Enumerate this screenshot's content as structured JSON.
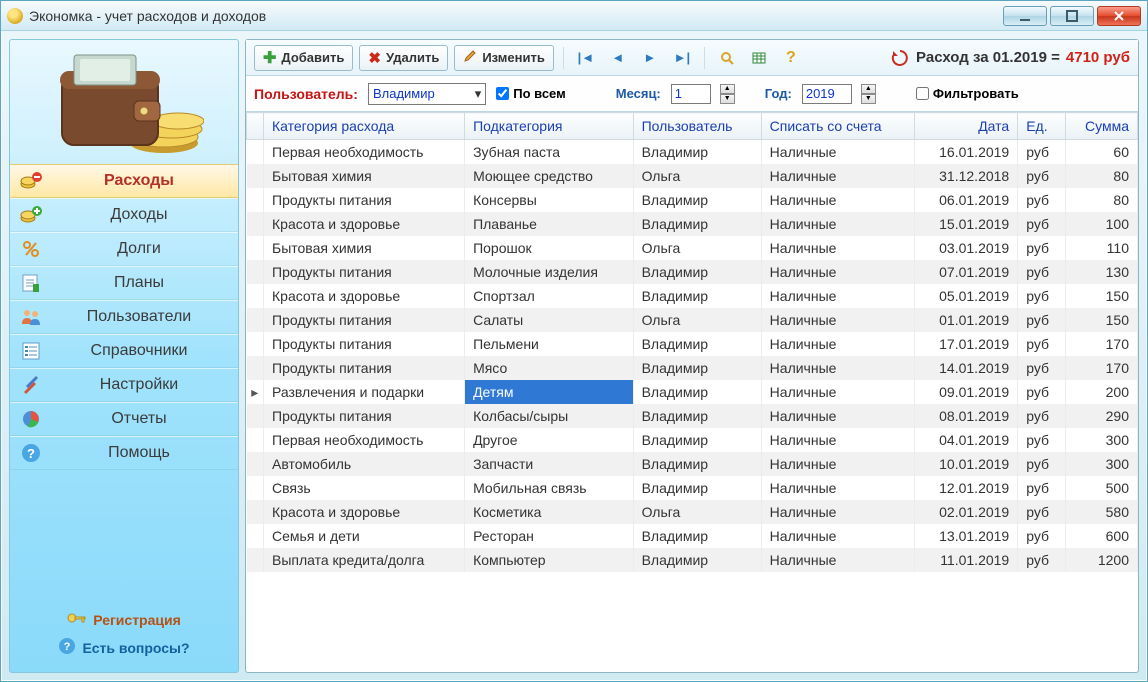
{
  "window": {
    "title": "Экономка - учет расходов и доходов"
  },
  "sidebar": {
    "items": [
      {
        "label": "Расходы"
      },
      {
        "label": "Доходы"
      },
      {
        "label": "Долги"
      },
      {
        "label": "Планы"
      },
      {
        "label": "Пользователи"
      },
      {
        "label": "Справочники"
      },
      {
        "label": "Настройки"
      },
      {
        "label": "Отчеты"
      },
      {
        "label": "Помощь"
      }
    ],
    "registration": "Регистрация",
    "questions": "Есть вопросы?"
  },
  "toolbar": {
    "add": "Добавить",
    "del": "Удалить",
    "edit": "Изменить",
    "summary_prefix": "Расход за 01.2019 = ",
    "summary_value": "4710 руб"
  },
  "filter": {
    "user_label": "Пользователь:",
    "user_value": "Владимир",
    "all_label": "По всем",
    "month_label": "Месяц:",
    "month_value": "1",
    "year_label": "Год:",
    "year_value": "2019",
    "filter_label": "Фильтровать"
  },
  "columns": [
    "Категория расхода",
    "Подкатегория",
    "Пользователь",
    "Списать со счета",
    "Дата",
    "Ед.",
    "Сумма"
  ],
  "rows": [
    {
      "cat": "Первая необходимость",
      "sub": "Зубная паста",
      "user": "Владимир",
      "acc": "Наличные",
      "date": "16.01.2019",
      "unit": "руб",
      "sum": "60",
      "sel": false
    },
    {
      "cat": "Бытовая химия",
      "sub": "Моющее средство",
      "user": "Ольга",
      "acc": "Наличные",
      "date": "31.12.2018",
      "unit": "руб",
      "sum": "80",
      "sel": false
    },
    {
      "cat": "Продукты питания",
      "sub": "Консервы",
      "user": "Владимир",
      "acc": "Наличные",
      "date": "06.01.2019",
      "unit": "руб",
      "sum": "80",
      "sel": false
    },
    {
      "cat": "Красота и здоровье",
      "sub": "Плаванье",
      "user": "Владимир",
      "acc": "Наличные",
      "date": "15.01.2019",
      "unit": "руб",
      "sum": "100",
      "sel": false
    },
    {
      "cat": "Бытовая химия",
      "sub": "Порошок",
      "user": "Ольга",
      "acc": "Наличные",
      "date": "03.01.2019",
      "unit": "руб",
      "sum": "110",
      "sel": false
    },
    {
      "cat": "Продукты питания",
      "sub": "Молочные изделия",
      "user": "Владимир",
      "acc": "Наличные",
      "date": "07.01.2019",
      "unit": "руб",
      "sum": "130",
      "sel": false
    },
    {
      "cat": "Красота и здоровье",
      "sub": "Спортзал",
      "user": "Владимир",
      "acc": "Наличные",
      "date": "05.01.2019",
      "unit": "руб",
      "sum": "150",
      "sel": false
    },
    {
      "cat": "Продукты питания",
      "sub": "Салаты",
      "user": "Ольга",
      "acc": "Наличные",
      "date": "01.01.2019",
      "unit": "руб",
      "sum": "150",
      "sel": false
    },
    {
      "cat": "Продукты питания",
      "sub": "Пельмени",
      "user": "Владимир",
      "acc": "Наличные",
      "date": "17.01.2019",
      "unit": "руб",
      "sum": "170",
      "sel": false
    },
    {
      "cat": "Продукты питания",
      "sub": "Мясо",
      "user": "Владимир",
      "acc": "Наличные",
      "date": "14.01.2019",
      "unit": "руб",
      "sum": "170",
      "sel": false
    },
    {
      "cat": "Развлечения и подарки",
      "sub": "Детям",
      "user": "Владимир",
      "acc": "Наличные",
      "date": "09.01.2019",
      "unit": "руб",
      "sum": "200",
      "sel": true
    },
    {
      "cat": "Продукты питания",
      "sub": "Колбасы/сыры",
      "user": "Владимир",
      "acc": "Наличные",
      "date": "08.01.2019",
      "unit": "руб",
      "sum": "290",
      "sel": false
    },
    {
      "cat": "Первая необходимость",
      "sub": "Другое",
      "user": "Владимир",
      "acc": "Наличные",
      "date": "04.01.2019",
      "unit": "руб",
      "sum": "300",
      "sel": false
    },
    {
      "cat": "Автомобиль",
      "sub": "Запчасти",
      "user": "Владимир",
      "acc": "Наличные",
      "date": "10.01.2019",
      "unit": "руб",
      "sum": "300",
      "sel": false
    },
    {
      "cat": "Связь",
      "sub": "Мобильная связь",
      "user": "Владимир",
      "acc": "Наличные",
      "date": "12.01.2019",
      "unit": "руб",
      "sum": "500",
      "sel": false
    },
    {
      "cat": "Красота и здоровье",
      "sub": "Косметика",
      "user": "Ольга",
      "acc": "Наличные",
      "date": "02.01.2019",
      "unit": "руб",
      "sum": "580",
      "sel": false
    },
    {
      "cat": "Семья и дети",
      "sub": "Ресторан",
      "user": "Владимир",
      "acc": "Наличные",
      "date": "13.01.2019",
      "unit": "руб",
      "sum": "600",
      "sel": false
    },
    {
      "cat": "Выплата кредита/долга",
      "sub": "Компьютер",
      "user": "Владимир",
      "acc": "Наличные",
      "date": "11.01.2019",
      "unit": "руб",
      "sum": "1200",
      "sel": false
    }
  ]
}
